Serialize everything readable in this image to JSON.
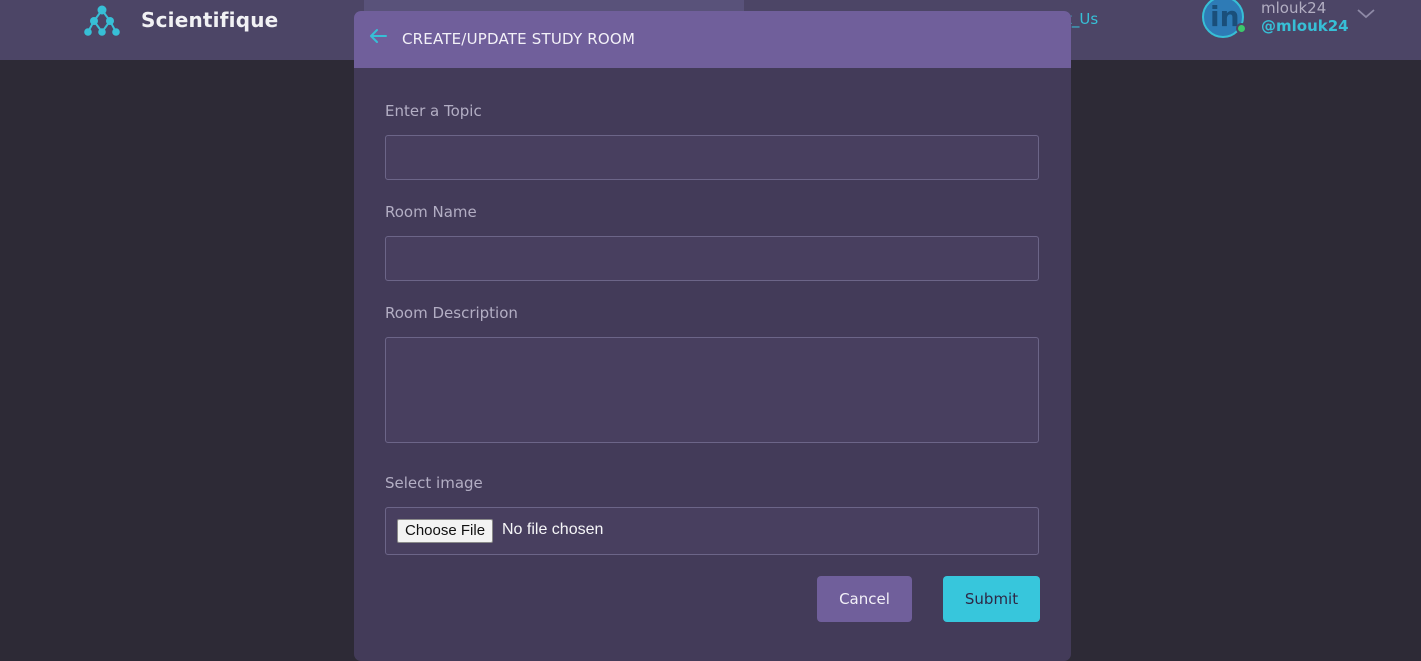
{
  "header": {
    "brand": "Scientifique",
    "nav_link": "t_Us",
    "user": {
      "name": "mlouk24",
      "handle": "@mlouk24",
      "avatar_letter": "in",
      "status": "online"
    },
    "icons": {
      "logo": "network-logo-icon",
      "dropdown": "chevron-down-icon"
    }
  },
  "modal": {
    "title": "CREATE/UPDATE STUDY ROOM",
    "back_icon": "arrow-left-icon",
    "fields": {
      "topic": {
        "label": "Enter a Topic",
        "value": ""
      },
      "room_name": {
        "label": "Room Name",
        "value": ""
      },
      "description": {
        "label": "Room Description",
        "value": ""
      },
      "image": {
        "label": "Select image",
        "button": "Choose File",
        "status": "No file chosen"
      }
    },
    "buttons": {
      "cancel": "Cancel",
      "submit": "Submit"
    }
  },
  "colors": {
    "accent": "#37bfd6",
    "header_bg": "#4c4566",
    "modal_bg": "#433b59",
    "modal_header_bg": "#705f9b",
    "page_bg": "#2d2a36"
  }
}
